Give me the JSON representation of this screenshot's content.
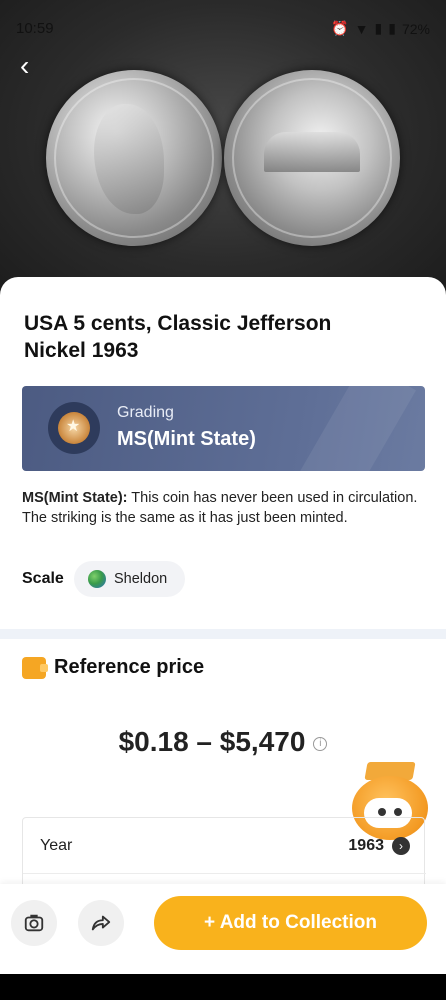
{
  "status": {
    "time": "10:59",
    "battery": "72%"
  },
  "coin": {
    "title": "USA 5 cents, Classic Jefferson Nickel 1963"
  },
  "grading": {
    "label": "Grading",
    "value": "MS(Mint State)"
  },
  "description": {
    "term": "MS(Mint State):",
    "text": "This coin has never been used in circulation. The striking is the same as it has just been minted."
  },
  "scale": {
    "label": "Scale",
    "value": "Sheldon"
  },
  "reference": {
    "title": "Reference price",
    "price": "$0.18 – $5,470"
  },
  "details": [
    {
      "label": "Year",
      "value": "1963"
    }
  ],
  "actions": {
    "add_label": "+ Add to Collection"
  },
  "colors": {
    "accent": "#f9b21c",
    "grading_bg": "#55648b"
  }
}
